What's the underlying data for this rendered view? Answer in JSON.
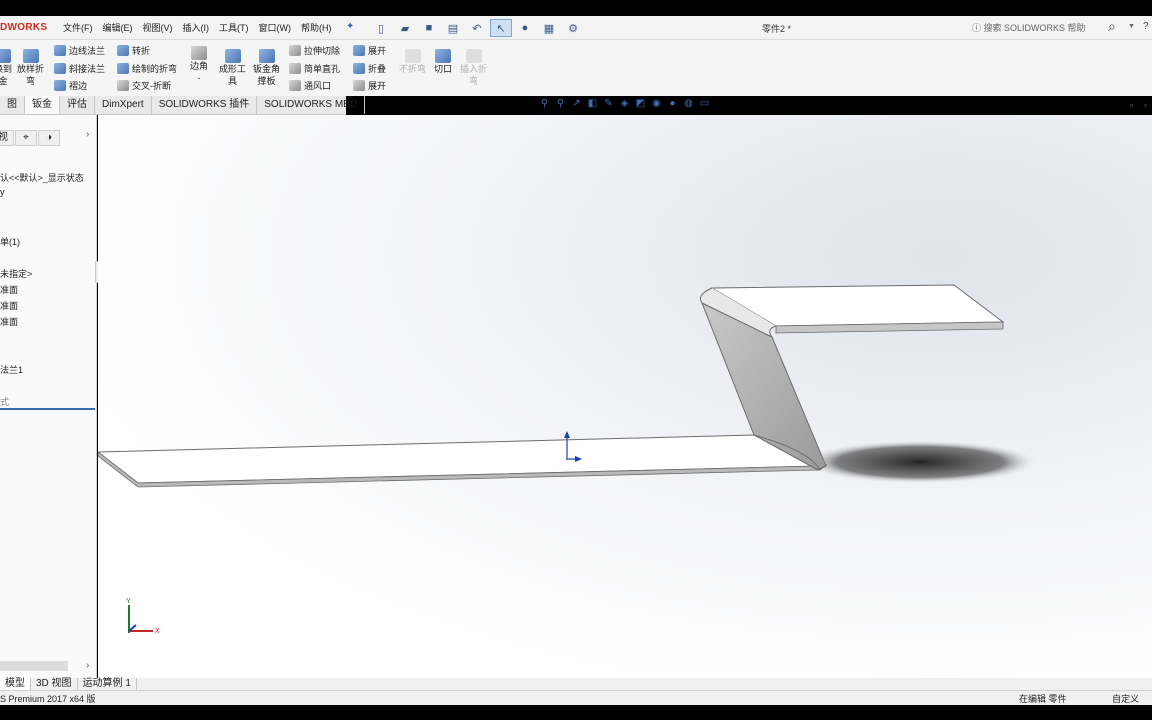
{
  "app": {
    "logo": "DWORKS",
    "doc_title": "零件2 *",
    "search_placeholder": "搜索 SOLIDWORKS 帮助"
  },
  "menu": [
    "文件(F)",
    "编辑(E)",
    "视图(V)",
    "插入(I)",
    "工具(T)",
    "窗口(W)",
    "帮助(H)"
  ],
  "ribbon": {
    "col1": [
      "边线法兰",
      "斜接法兰",
      "褶边"
    ],
    "col0a": [
      "换到",
      "金"
    ],
    "col0b": [
      "放样折",
      "弯"
    ],
    "col2": [
      "转折",
      "绘制的折弯",
      "交叉-折断"
    ],
    "corner": "边角",
    "form_tool": [
      "成形工",
      "具"
    ],
    "gusset": [
      "钣金角",
      "撑板"
    ],
    "col3": [
      "拉伸切除",
      "简单直孔",
      "通风口"
    ],
    "col4": [
      "展开",
      "折叠",
      "展开"
    ],
    "no_bend": "不折弯",
    "rip": "切口",
    "insert_bend": [
      "插入折",
      "弯"
    ]
  },
  "tabs": [
    "图",
    "钣金",
    "评估",
    "DimXpert",
    "SOLIDWORKS 插件",
    "SOLIDWORKS MBD"
  ],
  "tree": [
    "认<<默认>_显示状态",
    "y",
    "单(1)",
    "未指定>",
    "准面",
    "准面",
    "准面",
    "法兰1",
    "式"
  ],
  "panel_tabs": [
    "视",
    "⌖",
    "◑"
  ],
  "bottom_tabs": [
    "模型",
    "3D 视图",
    "运动算例 1"
  ],
  "status": {
    "version": "S Premium 2017 x64 版",
    "editing": "在编辑 零件",
    "custom": "自定义"
  },
  "triad": {
    "x": "X",
    "y": "Y"
  },
  "colors": {
    "accent": "#d52b1e",
    "part_face": "#ffffff",
    "part_side": "#a9a9a9",
    "shadow": "#1a1a1a"
  }
}
